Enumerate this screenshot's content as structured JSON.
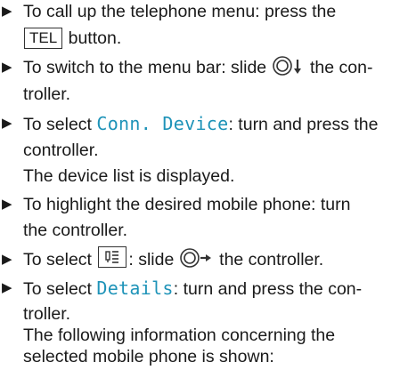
{
  "colors": {
    "text": "#1a1a1a",
    "highlight": "#1e93b8"
  },
  "icons": {
    "bullet": "right-triangle-arrow",
    "controller_down": "controller-slide-down-icon",
    "controller_right": "controller-slide-right-icon",
    "details_key": "phone-details-key-icon"
  },
  "step1": {
    "bullet": "▶",
    "line1": "To call up the telephone menu: press the",
    "key": "TEL",
    "line2_suffix": " button."
  },
  "step2": {
    "bullet": "▶",
    "prefix": "To switch to the menu bar: slide ",
    "suffix": " the con-",
    "line2": "troller."
  },
  "step3": {
    "bullet": "▶",
    "prefix": "To select ",
    "menu_item": "Conn. Device",
    "suffix": ": turn and press the",
    "line2": "controller.",
    "result": "The device list is displayed."
  },
  "step4": {
    "bullet": "▶",
    "line1": "To highlight the desired mobile phone: turn",
    "line2": "the controller."
  },
  "step5": {
    "bullet": "▶",
    "prefix": "To select ",
    "middle": ": slide ",
    "suffix": " the controller."
  },
  "step6": {
    "bullet": "▶",
    "prefix": "To select ",
    "menu_item": "Details",
    "suffix": ": turn and press the con-",
    "line2": "troller.",
    "result1": "The following information concerning the",
    "result2": "selected mobile phone is shown:"
  }
}
